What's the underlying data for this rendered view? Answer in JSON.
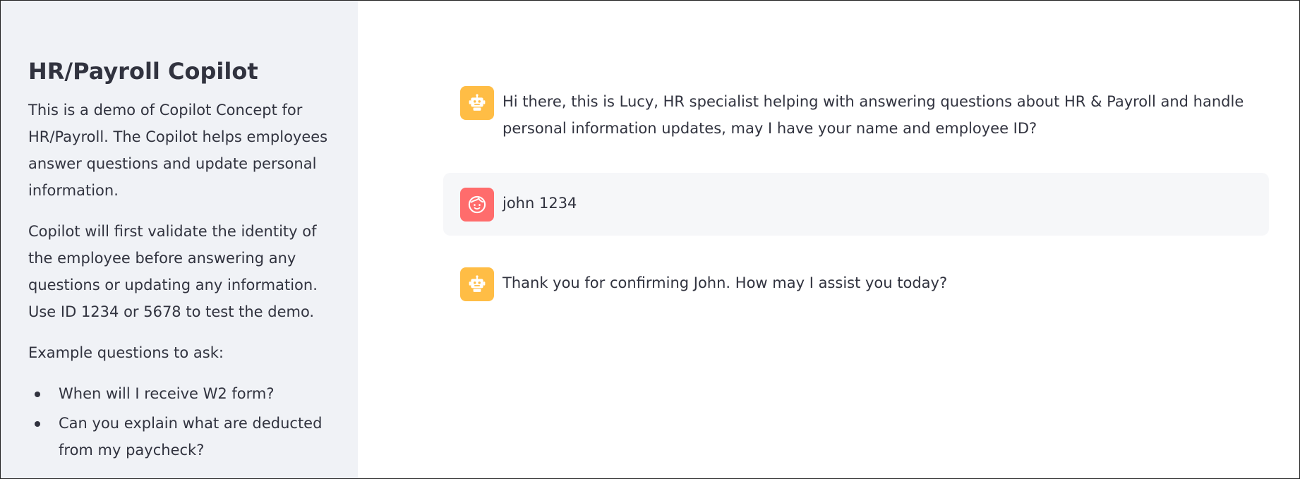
{
  "sidebar": {
    "title": "HR/Payroll Copilot",
    "paragraphs": [
      "This is a demo of Copilot Concept for HR/Payroll. The Copilot helps employees answer questions and update personal information.",
      "Copilot will first validate the identity of the employee before answering any questions or updating any information. Use ID 1234 or 5678 to test the demo.",
      "Example questions to ask:"
    ],
    "examples": [
      "When will I receive W2 form?",
      "Can you explain what are deducted from my paycheck?"
    ]
  },
  "chat": {
    "messages": [
      {
        "role": "assistant",
        "avatar_icon": "robot-icon",
        "text": "Hi there, this is Lucy, HR specialist helping with answering questions about HR & Payroll and handle personal information updates, may I have your name and employee ID?"
      },
      {
        "role": "user",
        "avatar_icon": "face-icon",
        "text": "john 1234"
      },
      {
        "role": "assistant",
        "avatar_icon": "robot-icon",
        "text": "Thank you for confirming John. How may I assist you today?"
      }
    ]
  },
  "colors": {
    "sidebar_bg": "#f0f2f6",
    "assistant_avatar": "#ffbd45",
    "user_avatar": "#ff6c6c",
    "user_message_bg": "#f6f7f9"
  }
}
